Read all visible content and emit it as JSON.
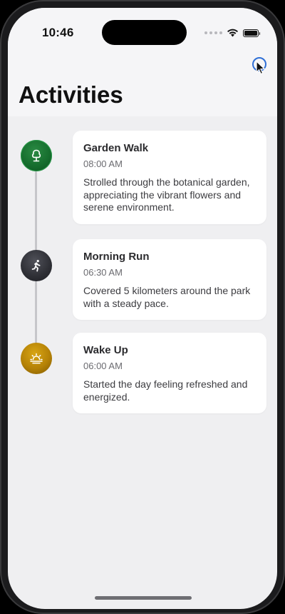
{
  "status_bar": {
    "time": "10:46"
  },
  "header": {
    "title": "Activities"
  },
  "colors": {
    "accent": "#2f6fd6",
    "green": "#166e2e",
    "dark": "#2d2e34",
    "yellow": "#b58206",
    "background": "#efeff1",
    "card": "#ffffff"
  },
  "activities": [
    {
      "title": "Garden Walk",
      "time": "08:00 AM",
      "description": "Strolled through the botanical garden, appreciating the vibrant flowers and serene environment.",
      "icon": "tree-icon",
      "color": "green"
    },
    {
      "title": "Morning Run",
      "time": "06:30 AM",
      "description": "Covered 5 kilometers around the park with a steady pace.",
      "icon": "running-figure-icon",
      "color": "dark"
    },
    {
      "title": "Wake Up",
      "time": "06:00 AM",
      "description": "Started the day feeling refreshed and energized.",
      "icon": "sunrise-icon",
      "color": "yellow"
    }
  ]
}
